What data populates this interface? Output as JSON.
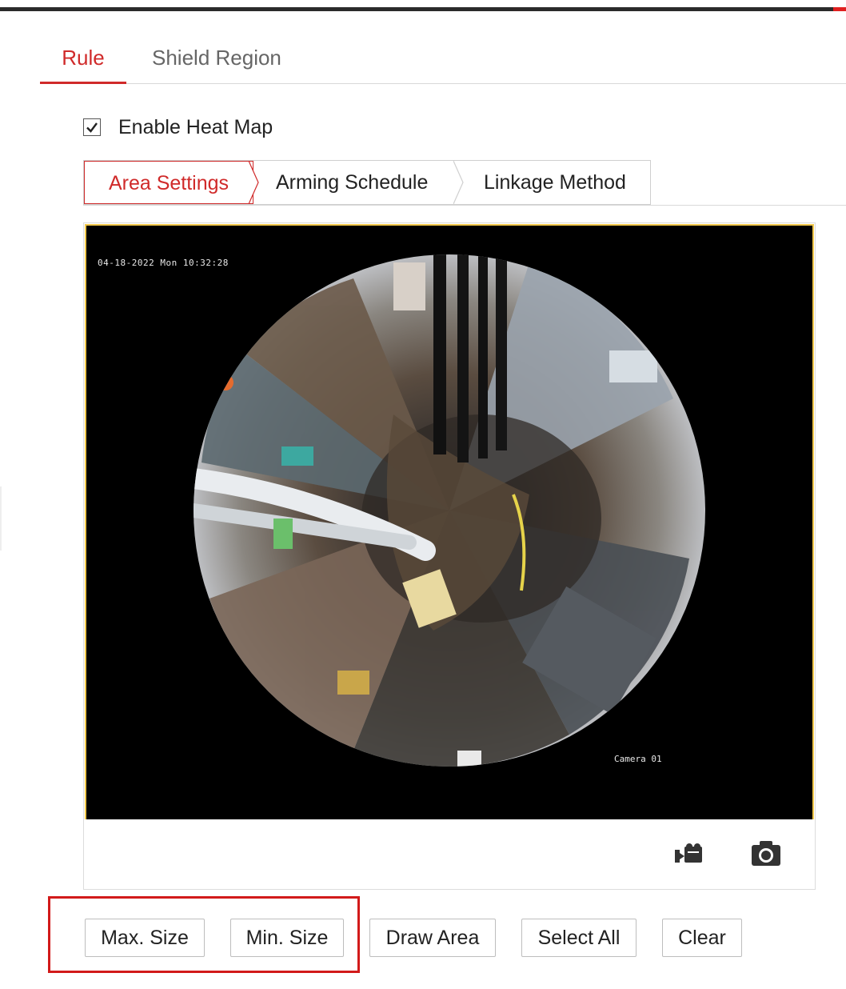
{
  "tabs": {
    "rule": "Rule",
    "shield_region": "Shield Region",
    "active": "Rule"
  },
  "enable_heat_map": {
    "label": "Enable Heat Map",
    "checked": true
  },
  "subtabs": {
    "area_settings": "Area Settings",
    "arming_schedule": "Arming Schedule",
    "linkage_method": "Linkage Method",
    "active": "Area Settings"
  },
  "video": {
    "timestamp": "04-18-2022 Mon 10:32:28",
    "camera_label": "Camera 01"
  },
  "toolbar": {
    "record_icon": "video-record-icon",
    "snapshot_icon": "camera-snapshot-icon"
  },
  "buttons": {
    "max_size": "Max. Size",
    "min_size": "Min. Size",
    "draw_area": "Draw Area",
    "select_all": "Select All",
    "clear": "Clear"
  },
  "colors": {
    "accent": "#d02a2a",
    "highlight_box": "#d21a1a",
    "video_border": "#f2c94c"
  }
}
